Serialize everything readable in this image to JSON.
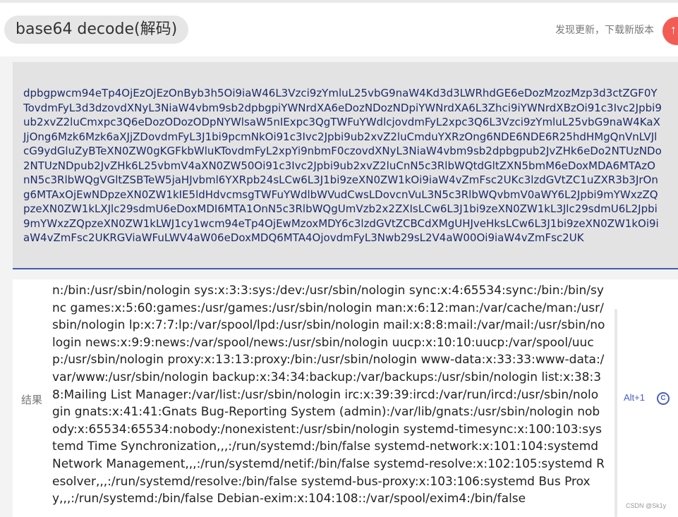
{
  "header": {
    "title": "base64 decode(解码)",
    "update_text": "发现更新，下载新版本",
    "update_icon": "arrow-up-icon",
    "update_color": "#f25c54"
  },
  "input": {
    "value": "dpbgpwcm94eTp4OjEzOjEzOnByb3h5Oi9iaW46L3Vzci9zYmluL25vbG9naW4Kd3d3LWRhdGE6eDozMzozMzp3d3ctZGF0YTovdmFyL3d3dzovdXNyL3NiaW4vbm9sb2dpbgpiYWNrdXA6eDozNDozNDpiYWNrdXA6L3Zhci9iYWNrdXBzOi91c3Ivc2Jpbi9ub2xvZ2luCmxpc3Q6eDozODozODpNYWlsaW5nIExpc3QgTWFuYWdlcjovdmFyL2xpc3Q6L3Vzci9zYmluL25vbG9naW4KaXJjOng6Mzk6Mzk6aXJjZDovdmFyL3J1bi9pcmNkOi91c3Ivc2Jpbi9ub2xvZ2luCmduYXRzOng6NDE6NDE6R25hdHMgQnVnLVJlcG9ydGluZyBTeXN0ZW0gKGFkbWluKTovdmFyL2xpYi9nbmF0czovdXNyL3NiaW4vbm9sb2dpbgpub2JvZHk6eDo2NTUzNDo2NTUzNDpub2JvZHk6L25vbmV4aXN0ZW50Oi91c3Ivc2Jpbi9ub2xvZ2luCnN5c3RlbWQtdGltZXN5bmM6eDoxMDA6MTAzOnN5c3RlbWQgVGltZSBTeW5jaHJvbml6YXRpb24sLCw6L3J1bi9zeXN0ZW1kOi9iaW4vZmFsc2UKc3lzdGVtZC1uZXR3b3JrOng6MTAxOjEwNDpzeXN0ZW1kIE5ldHdvcmsgTWFuYWdlbWVudCwsLDovcnVuL3N5c3RlbWQvbmV0aWY6L2Jpbi9mYWxzZQpzeXN0ZW1kLXJlc29sdmU6eDoxMDI6MTA1OnN5c3RlbWQgUmVzb2x2ZXIsLCw6L3J1bi9zeXN0ZW1kL3Jlc29sdmU6L2Jpbi9mYWxzZQpzeXN0ZW1kLWJ1cy1wcm94eTp4OjEwMzoxMDY6c3lzdGVtZCBCdXMgUHJveHksLCw6L3J1bi9zeXN0ZW1kOi9iaW4vZmFsc2UKRGViaWFuLWV4aW06eDoxMDQ6MTA4OjovdmFyL3Nwb29sL2V4aW00Oi9iaW4vZmFsc2UK"
  },
  "result": {
    "label": "结果",
    "value": "n:/bin:/usr/sbin/nologin sys:x:3:3:sys:/dev:/usr/sbin/nologin sync:x:4:65534:sync:/bin:/bin/sync games:x:5:60:games:/usr/games:/usr/sbin/nologin man:x:6:12:man:/var/cache/man:/usr/sbin/nologin lp:x:7:7:lp:/var/spool/lpd:/usr/sbin/nologin mail:x:8:8:mail:/var/mail:/usr/sbin/nologin news:x:9:9:news:/var/spool/news:/usr/sbin/nologin uucp:x:10:10:uucp:/var/spool/uucp:/usr/sbin/nologin proxy:x:13:13:proxy:/bin:/usr/sbin/nologin www-data:x:33:33:www-data:/var/www:/usr/sbin/nologin backup:x:34:34:backup:/var/backups:/usr/sbin/nologin list:x:38:38:Mailing List Manager:/var/list:/usr/sbin/nologin irc:x:39:39:ircd:/var/run/ircd:/usr/sbin/nologin gnats:x:41:41:Gnats Bug-Reporting System (admin):/var/lib/gnats:/usr/sbin/nologin nobody:x:65534:65534:nobody:/nonexistent:/usr/sbin/nologin systemd-timesync:x:100:103:systemd Time Synchronization,,,:/run/systemd:/bin/false systemd-network:x:101:104:systemd Network Management,,,:/run/systemd/netif:/bin/false systemd-resolve:x:102:105:systemd Resolver,,,:/run/systemd/resolve:/bin/false systemd-bus-proxy:x:103:106:systemd Bus Proxy,,,:/run/systemd:/bin/false Debian-exim:x:104:108::/var/spool/exim4:/bin/false",
    "shortcut": "Alt+1",
    "copy_icon_glyph": "C"
  },
  "watermark": "CSDN @Sk1y"
}
